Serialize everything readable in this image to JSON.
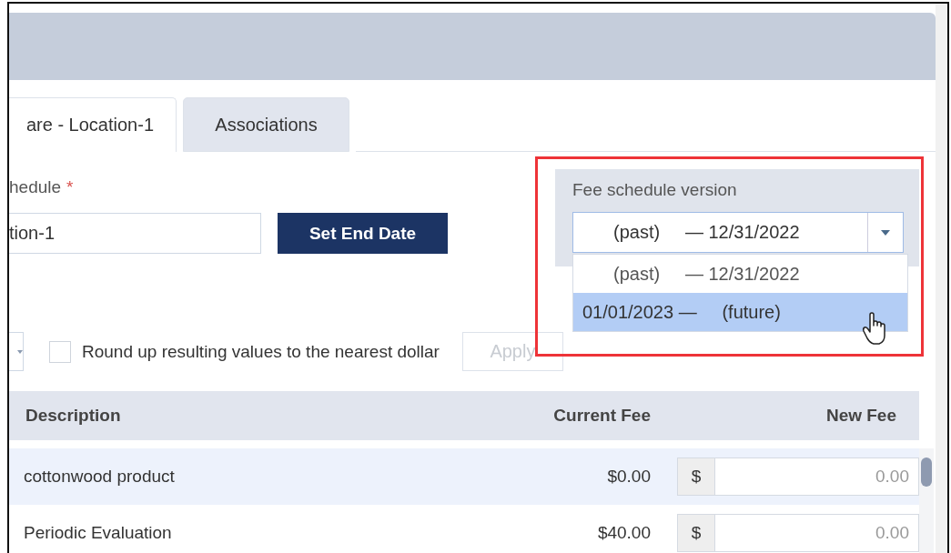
{
  "tabs": [
    {
      "label": "are - Location-1",
      "selected": true
    },
    {
      "label": "Associations",
      "selected": false
    }
  ],
  "fee_schedule": {
    "label": "hedule",
    "required_mark": "*",
    "value": "tion-1"
  },
  "set_end_date_button": "Set End Date",
  "version": {
    "label": "Fee schedule version",
    "value": "(past)     — 12/31/2022",
    "expanded": true,
    "options": [
      {
        "label": "(past)     — 12/31/2022",
        "highlighted": false
      },
      {
        "label": "01/01/2023 —     (future)",
        "highlighted": true
      }
    ]
  },
  "round_up": {
    "label": "Round up resulting values to the nearest dollar",
    "checked": false
  },
  "apply_button": {
    "label": "Apply",
    "disabled": true
  },
  "table": {
    "columns": [
      "Description",
      "Current Fee",
      "New Fee"
    ],
    "rows": [
      {
        "description": "cottonwood product",
        "current_fee": "$0.00",
        "currency": "$",
        "new_fee": "0.00",
        "selected": true
      },
      {
        "description": "Periodic Evaluation",
        "current_fee": "$40.00",
        "currency": "$",
        "new_fee": "0.00",
        "selected": false
      }
    ]
  }
}
